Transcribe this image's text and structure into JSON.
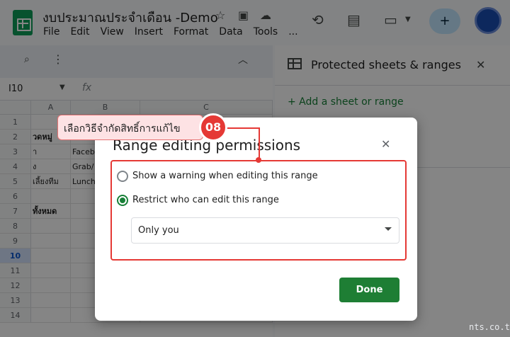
{
  "app": {
    "title": "งบประมาณประจำเดือน -Demo",
    "menu": [
      "File",
      "Edit",
      "View",
      "Insert",
      "Format",
      "Data",
      "Tools",
      "..."
    ]
  },
  "formula_bar": {
    "cell_ref": "I10",
    "fx": "fx"
  },
  "grid": {
    "columns": [
      "A",
      "B",
      "C"
    ],
    "rows": [
      "1",
      "2",
      "3",
      "4",
      "5",
      "6",
      "7",
      "8",
      "9",
      "10",
      "11",
      "12",
      "13",
      "14"
    ],
    "selected_row": "10",
    "cells": [
      {
        "row": 2,
        "col": "A",
        "text": "วดหมู่",
        "bold": true
      },
      {
        "row": 3,
        "col": "A",
        "text": "า",
        "bold": false
      },
      {
        "row": 3,
        "col": "B",
        "text": "Facebo",
        "bold": false
      },
      {
        "row": 4,
        "col": "A",
        "text": "ง",
        "bold": false
      },
      {
        "row": 4,
        "col": "B",
        "text": "Grab/",
        "bold": false
      },
      {
        "row": 5,
        "col": "A",
        "text": "เลี้ยงทีม",
        "bold": false
      },
      {
        "row": 5,
        "col": "B",
        "text": "Lunch",
        "bold": false
      },
      {
        "row": 7,
        "col": "A",
        "text": "ทั้งหมด",
        "bold": true
      }
    ]
  },
  "panel": {
    "title": "Protected sheets & ranges",
    "add_label": "+ Add a sheet or range"
  },
  "dialog": {
    "title": "Range editing permissions",
    "option_warning": "Show a warning when editing this range",
    "option_restrict": "Restrict who can edit this range",
    "selected_option": "restrict",
    "dropdown_value": "Only you",
    "done_label": "Done"
  },
  "annotation": {
    "text": "เลือกวิธีจำกัดสิทธิ์การแก้ไข",
    "step": "08",
    "color": "#e53935"
  },
  "watermark": "nts.co.th"
}
